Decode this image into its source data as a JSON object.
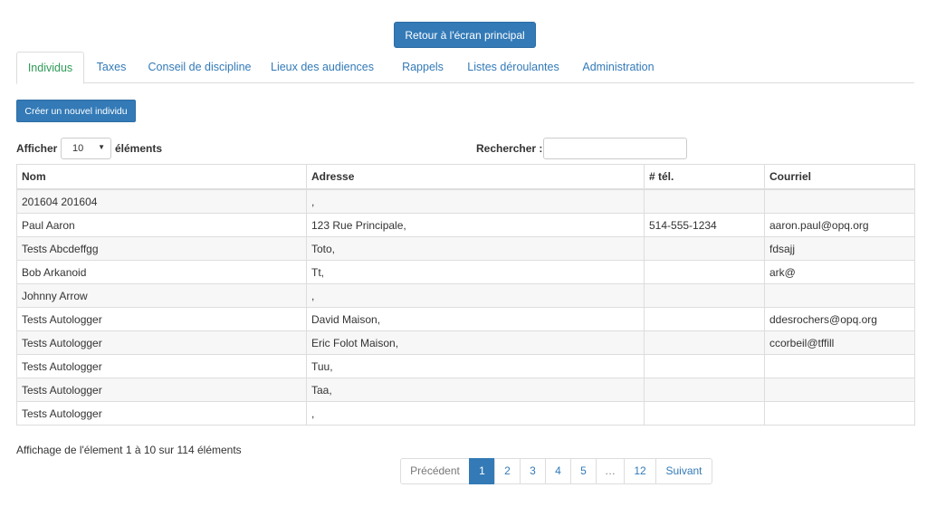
{
  "header": {
    "return_label": "Retour à l'écran principal"
  },
  "tabs": [
    {
      "label": "Individus",
      "active": true
    },
    {
      "label": "Taxes"
    },
    {
      "label": "Conseil de discipline"
    },
    {
      "label": "Lieux des audiences"
    },
    {
      "label": "Rappels"
    },
    {
      "label": "Listes déroulantes"
    },
    {
      "label": "Administration"
    }
  ],
  "toolbar": {
    "create_label": "Créer un nouvel individu"
  },
  "controls": {
    "show_label": "Afficher",
    "page_length": "10",
    "elements_label": "éléments",
    "search_label": "Rechercher :",
    "search_value": ""
  },
  "table": {
    "columns": [
      "Nom",
      "Adresse",
      "# tél.",
      "Courriel"
    ],
    "rows": [
      [
        "201604 201604",
        ",",
        "",
        ""
      ],
      [
        "Paul Aaron",
        "123 Rue Principale,",
        "514-555-1234",
        "aaron.paul@opq.org"
      ],
      [
        "Tests Abcdeffgg",
        "Toto,",
        "",
        "fdsajj"
      ],
      [
        "Bob Arkanoid",
        "Tt,",
        "",
        "ark@"
      ],
      [
        "Johnny Arrow",
        ",",
        "",
        ""
      ],
      [
        "Tests Autologger",
        "David Maison,",
        "",
        "ddesrochers@opq.org"
      ],
      [
        "Tests Autologger",
        "Eric Folot Maison,",
        "",
        "ccorbeil@tffill"
      ],
      [
        "Tests Autologger",
        "Tuu,",
        "",
        ""
      ],
      [
        "Tests Autologger",
        "Taa,",
        "",
        ""
      ],
      [
        "Tests Autologger",
        ",",
        "",
        ""
      ]
    ]
  },
  "info": "Affichage de l'élement 1 à 10 sur 114 éléments",
  "pagination": {
    "previous": "Précédent",
    "pages": [
      "1",
      "2",
      "3",
      "4",
      "5",
      "…",
      "12"
    ],
    "current": "1",
    "next": "Suivant"
  },
  "colors": {
    "primary": "#337ab7",
    "active_tab": "#2f9b57",
    "border": "#dddddd"
  }
}
